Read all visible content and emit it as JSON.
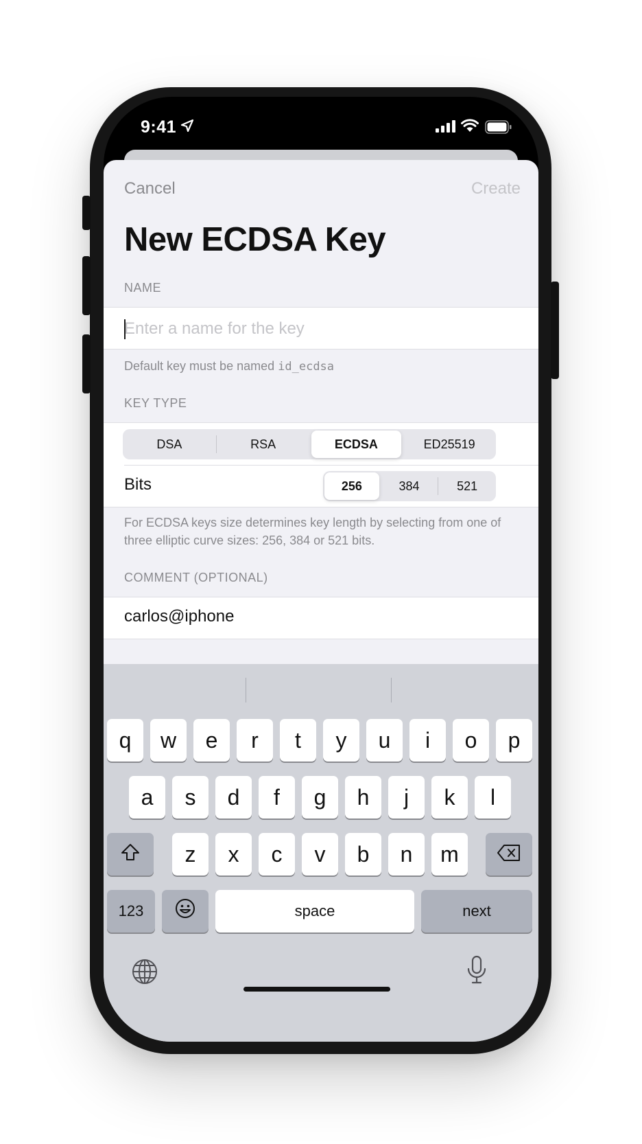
{
  "status_bar": {
    "time": "9:41"
  },
  "nav": {
    "cancel_label": "Cancel",
    "create_label": "Create"
  },
  "title": "New ECDSA Key",
  "name_section": {
    "header": "NAME",
    "placeholder": "Enter a name for the key",
    "value": "",
    "footer_prefix": "Default key must be named",
    "footer_code": "id_ecdsa"
  },
  "key_type_section": {
    "header": "KEY TYPE",
    "types": [
      "DSA",
      "RSA",
      "ECDSA",
      "ED25519"
    ],
    "selected_type": "ECDSA",
    "bits_label": "Bits",
    "bits_options": [
      "256",
      "384",
      "521"
    ],
    "selected_bits": "256",
    "footer": "For ECDSA keys size determines key length by selecting from one of three elliptic curve sizes: 256, 384 or 521 bits."
  },
  "comment_section": {
    "header": "COMMENT (OPTIONAL)",
    "value": "carlos@iphone"
  },
  "keyboard": {
    "row1": [
      "q",
      "w",
      "e",
      "r",
      "t",
      "y",
      "u",
      "i",
      "o",
      "p"
    ],
    "row2": [
      "a",
      "s",
      "d",
      "f",
      "g",
      "h",
      "j",
      "k",
      "l"
    ],
    "row3": [
      "z",
      "x",
      "c",
      "v",
      "b",
      "n",
      "m"
    ],
    "numbers_label": "123",
    "space_label": "space",
    "next_label": "next",
    "shift_icon": "shift-icon",
    "delete_icon": "delete-icon",
    "emoji_icon": "emoji-icon",
    "globe_icon": "globe-icon",
    "mic_icon": "mic-icon"
  },
  "colors": {
    "sheet_background": "#f1f1f6",
    "keyboard_background": "#d1d3d9",
    "secondary_text": "#8a8a8e"
  }
}
